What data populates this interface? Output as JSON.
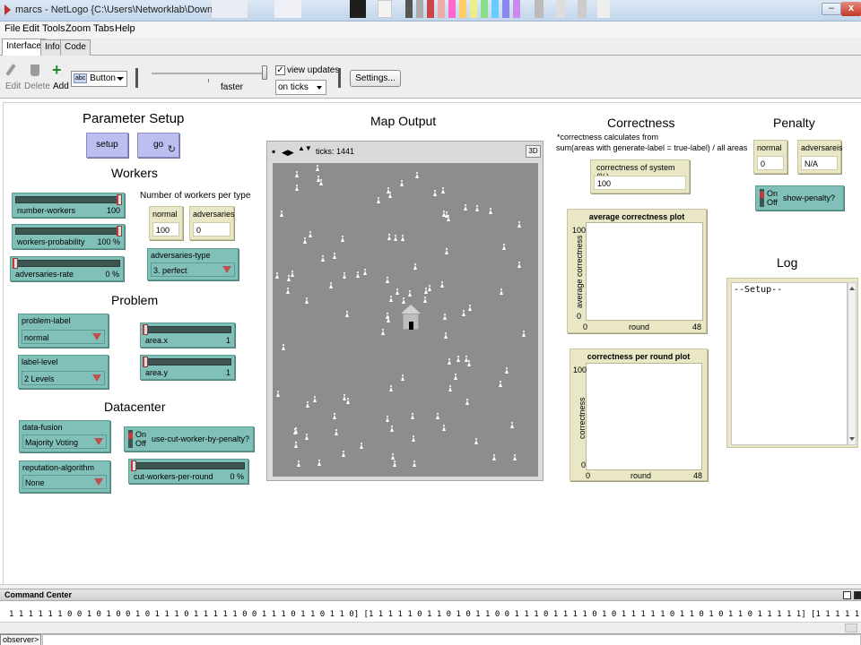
{
  "window": {
    "title": "marcs - NetLogo {C:\\Users\\Networklab\\Downloads}",
    "minimize_label": "–",
    "close_label": "x"
  },
  "menu": [
    "File",
    "Edit",
    "Tools",
    "Zoom",
    "Tabs",
    "Help"
  ],
  "tabs": [
    "Interface",
    "Info",
    "Code"
  ],
  "toolbar": {
    "edit": "Edit",
    "delete": "Delete",
    "add": "Add",
    "widget_type": "Button",
    "speed_label": "faster",
    "view_updates_label": "view updates",
    "view_updates_checked": true,
    "update_mode": "on ticks",
    "settings": "Settings..."
  },
  "parameter_setup": {
    "heading": "Parameter Setup",
    "setup_btn": "setup",
    "go_btn": "go",
    "forever_glyph": "↻"
  },
  "workers": {
    "heading": "Workers",
    "number_workers": {
      "label": "number-workers",
      "value": "100"
    },
    "workers_probability": {
      "label": "workers-probability",
      "value": "100 %"
    },
    "adversaries_rate": {
      "label": "adversaries-rate",
      "value": "0 %"
    },
    "per_type_label": "Number of workers per type",
    "normal": {
      "label": "normal",
      "value": "100"
    },
    "adversaries": {
      "label": "adversaries",
      "value": "0"
    },
    "adversaries_type": {
      "label": "adversaries-type",
      "value": "3. perfect"
    }
  },
  "problem": {
    "heading": "Problem",
    "problem_label": {
      "label": "problem-label",
      "value": "normal"
    },
    "area_x": {
      "label": "area.x",
      "value": "1"
    },
    "label_level": {
      "label": "label-level",
      "value": "2 Levels"
    },
    "area_y": {
      "label": "area.y",
      "value": "1"
    }
  },
  "datacenter": {
    "heading": "Datacenter",
    "data_fusion": {
      "label": "data-fusion",
      "value": "Majority Voting"
    },
    "use_cut": {
      "label": "use-cut-worker-by-penalty?",
      "on": "On",
      "off": "Off"
    },
    "reputation_algorithm": {
      "label": "reputation-algorithm",
      "value": "None"
    },
    "cut_workers": {
      "label": "cut-workers-per-round",
      "value": "0 %"
    }
  },
  "map": {
    "heading": "Map Output",
    "ticks_label": "ticks: 1441",
    "btn_3d": "3D",
    "ctrl_icons": [
      "▪",
      "◀▶",
      "▲▼"
    ]
  },
  "correctness": {
    "heading": "Correctness",
    "note_1": "*correctness calculates from",
    "note_2": "sum(areas with generate-label = true-label) / all areas",
    "system": {
      "label": "correctness of system (%)",
      "value": "100"
    }
  },
  "penalty": {
    "heading": "Penalty",
    "normal": {
      "label": "normal",
      "value": "0"
    },
    "adversaries": {
      "label": "adversareis",
      "value": "N/A"
    },
    "show_penalty": {
      "label": "show-penalty?",
      "on": "On",
      "off": "Off"
    }
  },
  "plots": [
    {
      "title": "average correctness plot",
      "ylabel": "average correctness",
      "y_max": "100",
      "y_min": "0",
      "x_min": "0",
      "x_max": "48",
      "xlabel": "round"
    },
    {
      "title": "correctness per round plot",
      "ylabel": "correctness",
      "y_max": "100",
      "y_min": "0",
      "x_min": "0",
      "x_max": "48",
      "xlabel": "round"
    }
  ],
  "log": {
    "heading": "Log",
    "content": "--Setup--"
  },
  "command_center": {
    "title": "Command Center",
    "output": "1 1 1 1 1 1 0 0 1 0 1 0 0 1 0 1 1 1 0 1 1 1 1 1 0 0 1 1 1 0 1 1 0 1 1 0] [1 1 1 1 1 0 1 1 0 1 0 1 1 0 0 1 1 1 0 1 1 1 1 0 1 0 1 1 1 1 1 0 1 1 0 1 0 1 1 0 1 1 1 1 1] [1 1 1 1 1",
    "observer": "observer>"
  },
  "colors": {
    "button": "#bcbeef",
    "slider": "#80c0b8",
    "monitor": "#e9e7c6",
    "world": "#8d8d8d",
    "knob_accent": "#c23a3a"
  },
  "icons": {
    "edit": "pencil-icon",
    "delete": "trash-icon",
    "add": "plus-icon",
    "forever": "forever-loop-icon",
    "house": "datacenter-house-icon",
    "person": "worker-person-icon"
  }
}
